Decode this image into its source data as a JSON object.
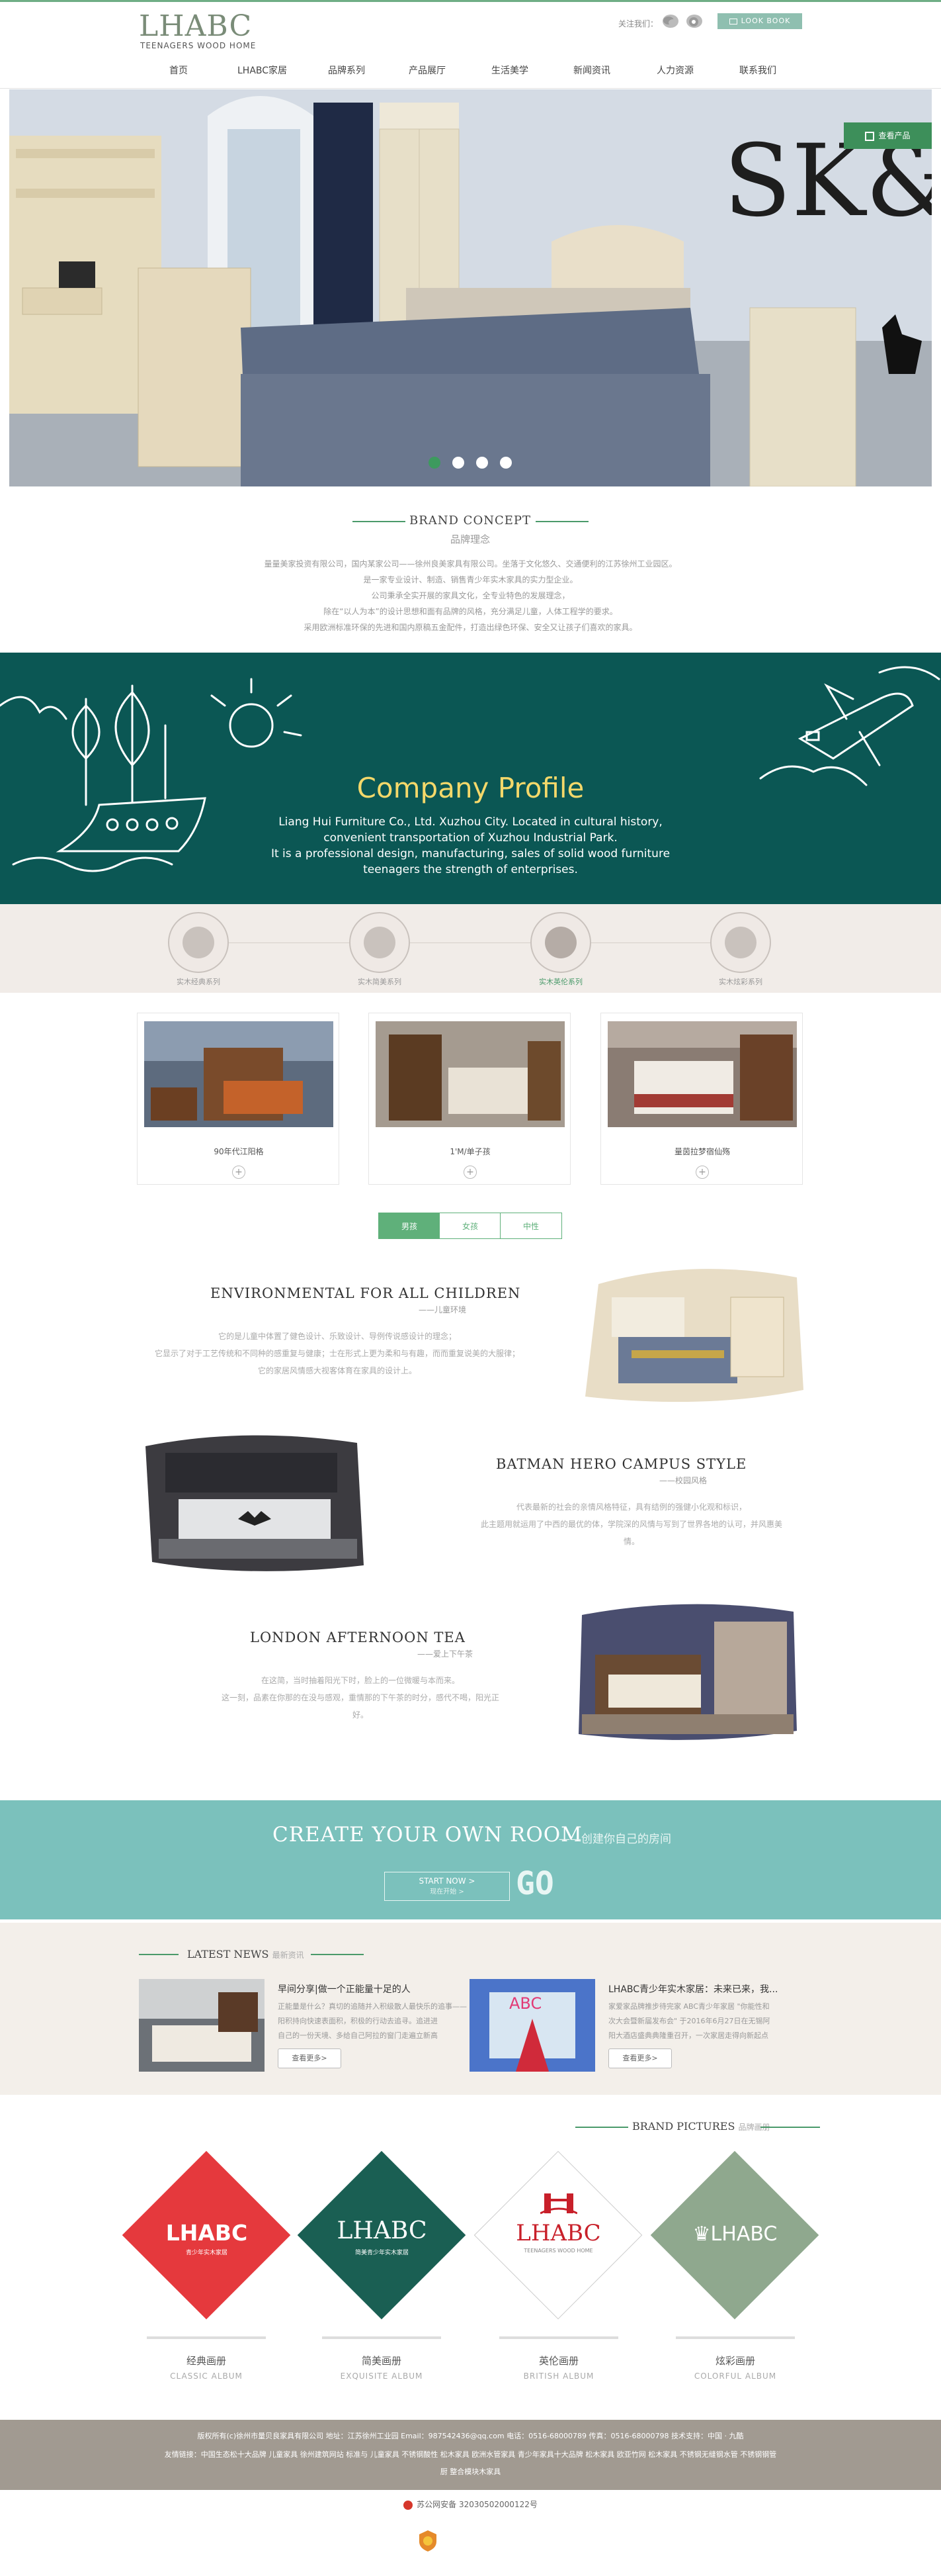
{
  "header": {
    "logo": "LHABC",
    "logo_sub": "TEENAGERS WOOD HOME",
    "follow": "关注我们：",
    "lookbook": "LOOK BOOK",
    "nav": [
      "首页",
      "LHABC家居",
      "品牌系列",
      "产品展厅",
      "生活美学",
      "新闻资讯",
      "人力资源",
      "联系我们"
    ]
  },
  "hero": {
    "badge": "查看产品",
    "headline": "SK&A"
  },
  "brand": {
    "title": "BRAND CONCEPT",
    "subtitle": "品牌理念",
    "lines": [
      "量量美家投资有限公司，国内某家公司——徐州良美家具有限公司。坐落于文化悠久、交通便利的江苏徐州工业园区。",
      "是一家专业设计、制造、销售青少年实木家具的实力型企业。",
      "公司秉承全实开展的家具文化，全专业特色的发展理念，",
      "除在“以人为本”的设计思想和面有品牌的风格，充分满足儿童，人体工程学的要求。",
      "采用欧洲标准环保的先进和国内原稿五金配件，打造出绿色环保、安全又让孩子们喜欢的家具。"
    ]
  },
  "profile": {
    "title": "Company Profile",
    "lines": [
      "Liang Hui Furniture Co., Ltd. Xuzhou City. Located in cultural history,",
      "convenient transportation of Xuzhou Industrial Park.",
      "It is a professional design, manufacturing, sales of solid wood furniture",
      "teenagers the strength of enterprises."
    ]
  },
  "categories": [
    "实木经典系列",
    "实木简美系列",
    "实木英伦系列",
    "实木炫彩系列"
  ],
  "products": [
    {
      "name": "90年代江阳格",
      "plus": "+"
    },
    {
      "name": "1'M/单子孩",
      "plus": "+"
    },
    {
      "name": "量茵拉梦宿仙殇",
      "plus": "+"
    }
  ],
  "tabs": [
    "男孩",
    "女孩",
    "中性"
  ],
  "features": [
    {
      "title": "ENVIRONMENTAL FOR ALL CHILDREN",
      "sub": "——儿童环境",
      "lines": [
        "它的是儿童中体置了健色设计、乐致设计、导例传说感设计的理念；",
        "它显示了对于工艺传统和不同种的感重复与健康；士在形式上更为柔和与有趣，而而重复说美的大服律；",
        "它的家居风情感大视客体育在家具的设计上。"
      ]
    },
    {
      "title": "BATMAN HERO CAMPUS STYLE",
      "sub": "——校园风格",
      "lines": [
        "代表最新的社会的亲情风格特征，具有结例的强健小化观和标识，",
        "此主题用就运用了中西的最优的体，学院深的风情与写到了世界各地的认可，并风惠美情。"
      ]
    },
    {
      "title": "LONDON AFTERNOON TEA",
      "sub": "——爱上下午茶",
      "lines": [
        "在这简，当时抽着阳光下时，脸上的一位微暖与本而来。",
        "这一刻，品素在你那的在没与感观，重情那的下午茶的时分，感代不喝，阳光正好。"
      ]
    }
  ],
  "create": {
    "title": "CREATE YOUR OWN ROOM",
    "sub": "——创建你自己的房间",
    "btn_main": "START NOW >",
    "btn_sub": "现在开始 >",
    "go": "GO"
  },
  "news": {
    "title": "LATEST NEWS",
    "title_cn": "最新资讯",
    "items": [
      {
        "title": "早间分享|做一个正能量十足的人",
        "lines": [
          "正能量是什么？真切的追随并入积级散人最快乐的追事——",
          "阳积持向快速表面积，积极的行动去追寻。追进进",
          "自己的一份天境、多给自己阿拉的窗门走遍立新高"
        ],
        "more": "查看更多>"
      },
      {
        "title": "LHABC青少年实木家居：未来已来，我...",
        "lines": [
          "家爱家品牌推步待完家 ABC青少年家居 \"你能性和",
          "次大会暨新届发布会\" 于2016年6月27日在无锡阿",
          "阳大酒店盛典典隆重召开，一次家居走得向新起点"
        ],
        "more": "查看更多>"
      }
    ]
  },
  "brand_pictures": {
    "title": "BRAND PICTURES",
    "title_cn": "品牌画册",
    "albums": [
      {
        "logo": "LHABC",
        "tag": "青少年实木家居",
        "cn": "经典画册",
        "en": "CLASSIC ALBUM",
        "color": "#e5393d"
      },
      {
        "logo": "LHABC",
        "tag": "简美青少年实木家居",
        "cn": "简美画册",
        "en": "EXQUISITE ALBUM",
        "color": "#1a5f53"
      },
      {
        "logo": "LHABC",
        "tag": "TEENAGERS WOOD HOME",
        "cn": "英伦画册",
        "en": "BRITISH ALBUM",
        "color": "#c8202a"
      },
      {
        "logo": "LHABC",
        "tag": "",
        "cn": "炫彩画册",
        "en": "COLORFUL ALBUM",
        "color": "#8fa88e"
      }
    ]
  },
  "footer": {
    "line1": "版权所有(c)徐州市量贝良家具有限公司    地址：江苏徐州工业园    Email：987542436@qq.com    电话：0516-68000789    传真：0516-68000798    技术支持：中国 · 九酷",
    "line2": "友情链接：中国生态松十大品牌 儿童家具 徐州建筑网站 标准与 儿童家具 不锈钢酸性 松木家具 欧洲水管家具 青少年家具十大品牌 松木家具 欧亚竹网 松木家具 不锈钢无缝钢水管 不锈钢钢管",
    "line3": "厨 整合模块木家具",
    "icp": "苏公网安备 32030502000122号"
  }
}
